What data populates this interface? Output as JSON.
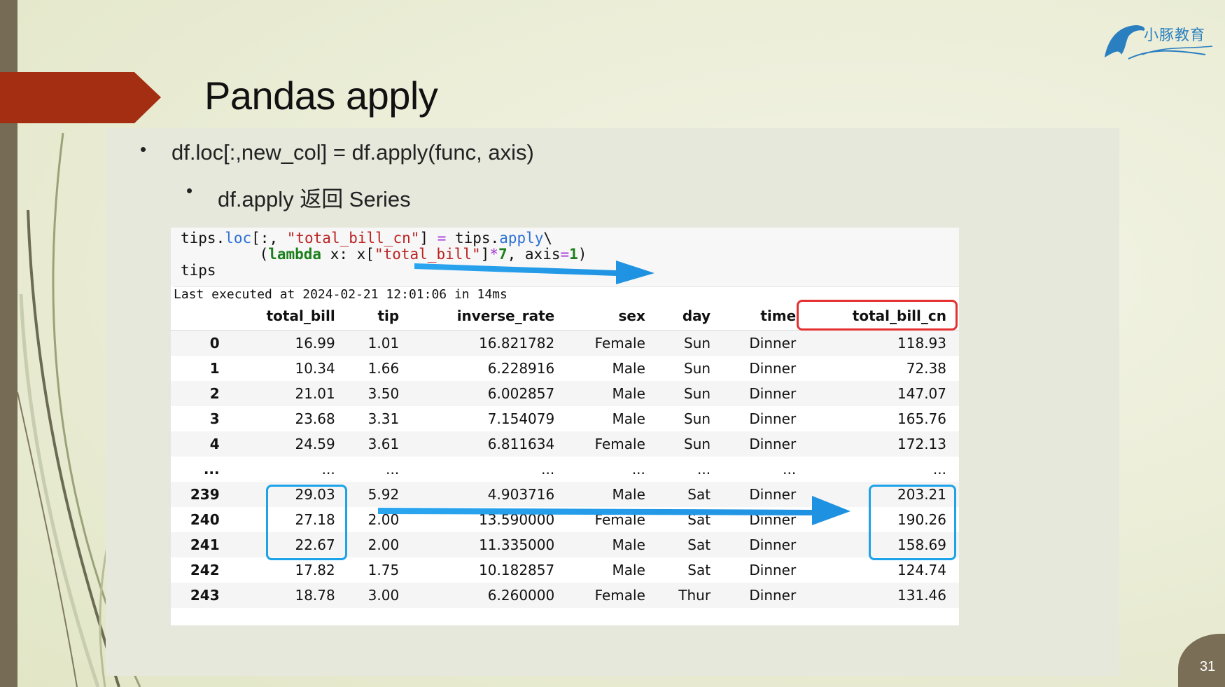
{
  "slide": {
    "title": "Pandas apply",
    "bullet1": "df.loc[:,new_col] = df.apply(func, axis)",
    "bullet2": "df.apply 返回  Series",
    "page_number": "31",
    "logo_text": "小豚教育"
  },
  "notebook": {
    "code": {
      "l1_a": "tips.",
      "l1_b": "loc",
      "l1_c": "[:, ",
      "l1_d": "\"total_bill_cn\"",
      "l1_e": "] ",
      "l1_f": "=",
      "l1_g": " tips.",
      "l1_h": "apply",
      "l1_i": "\\",
      "l2_a": "    (",
      "l2_b": "lambda",
      "l2_c": " x: x[",
      "l2_d": "\"total_bill\"",
      "l2_e": "]",
      "l2_f": "*",
      "l2_g": "7",
      "l2_h": ", axis",
      "l2_i": "=",
      "l2_j": "1",
      "l2_k": ")",
      "l3": "tips"
    },
    "exec_info": "Last executed at 2024-02-21 12:01:06 in 14ms",
    "table": {
      "headers": [
        "",
        "total_bill",
        "tip",
        "inverse_rate",
        "sex",
        "day",
        "time",
        "total_bill_cn"
      ],
      "rows": [
        [
          "0",
          "16.99",
          "1.01",
          "16.821782",
          "Female",
          "Sun",
          "Dinner",
          "118.93"
        ],
        [
          "1",
          "10.34",
          "1.66",
          "6.228916",
          "Male",
          "Sun",
          "Dinner",
          "72.38"
        ],
        [
          "2",
          "21.01",
          "3.50",
          "6.002857",
          "Male",
          "Sun",
          "Dinner",
          "147.07"
        ],
        [
          "3",
          "23.68",
          "3.31",
          "7.154079",
          "Male",
          "Sun",
          "Dinner",
          "165.76"
        ],
        [
          "4",
          "24.59",
          "3.61",
          "6.811634",
          "Female",
          "Sun",
          "Dinner",
          "172.13"
        ],
        [
          "...",
          "...",
          "...",
          "...",
          "...",
          "...",
          "...",
          "..."
        ],
        [
          "239",
          "29.03",
          "5.92",
          "4.903716",
          "Male",
          "Sat",
          "Dinner",
          "203.21"
        ],
        [
          "240",
          "27.18",
          "2.00",
          "13.590000",
          "Female",
          "Sat",
          "Dinner",
          "190.26"
        ],
        [
          "241",
          "22.67",
          "2.00",
          "11.335000",
          "Male",
          "Sat",
          "Dinner",
          "158.69"
        ],
        [
          "242",
          "17.82",
          "1.75",
          "10.182857",
          "Male",
          "Sat",
          "Dinner",
          "124.74"
        ],
        [
          "243",
          "18.78",
          "3.00",
          "6.260000",
          "Female",
          "Thur",
          "Dinner",
          "131.46"
        ]
      ]
    }
  },
  "colors": {
    "accent_red": "#a32e12",
    "highlight_red": "#e53030",
    "highlight_blue": "#1ea3e8"
  }
}
